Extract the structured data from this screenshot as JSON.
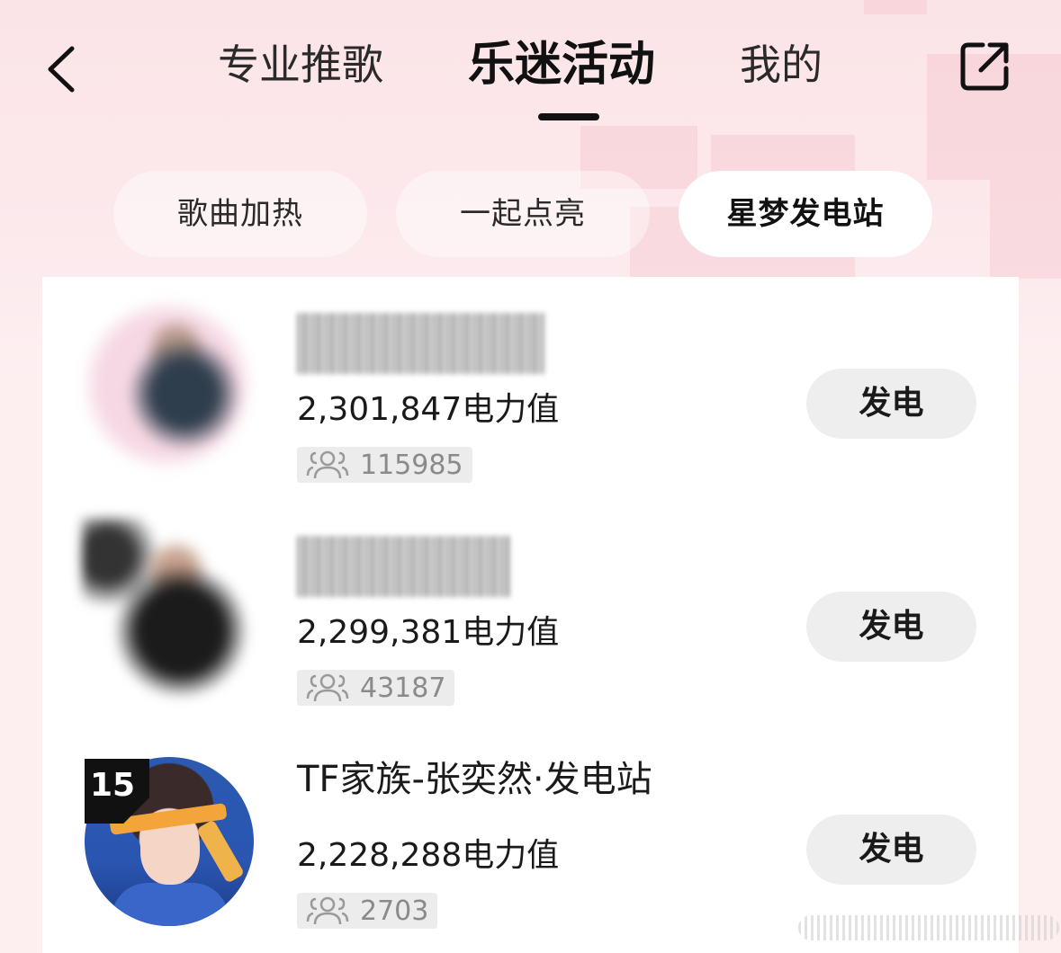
{
  "header": {
    "tabs": [
      {
        "label": "专业推歌",
        "active": false
      },
      {
        "label": "乐迷活动",
        "active": true
      },
      {
        "label": "我的",
        "active": false
      }
    ]
  },
  "subtabs": [
    {
      "label": "歌曲加热",
      "active": false
    },
    {
      "label": "一起点亮",
      "active": false
    },
    {
      "label": "星梦发电站",
      "active": true
    }
  ],
  "list": [
    {
      "name": "",
      "name_blurred": true,
      "power": "2,301,847电力值",
      "fans": "115985",
      "button": "发电"
    },
    {
      "name": "",
      "name_blurred": true,
      "power": "2,299,381电力值",
      "fans": "43187",
      "button": "发电"
    },
    {
      "name": "TF家族-张奕然·发电站",
      "name_blurred": false,
      "rank": "15",
      "power": "2,228,288电力值",
      "fans": "2703",
      "button": "发电"
    }
  ],
  "colors": {
    "background": "#fdeef0",
    "panel": "#ffffff",
    "button": "#eeeeee",
    "text": "#1a1a1a",
    "muted": "#8a8a8a"
  },
  "icons": [
    "back-chevron-icon",
    "share-external-icon",
    "fans-group-icon"
  ]
}
